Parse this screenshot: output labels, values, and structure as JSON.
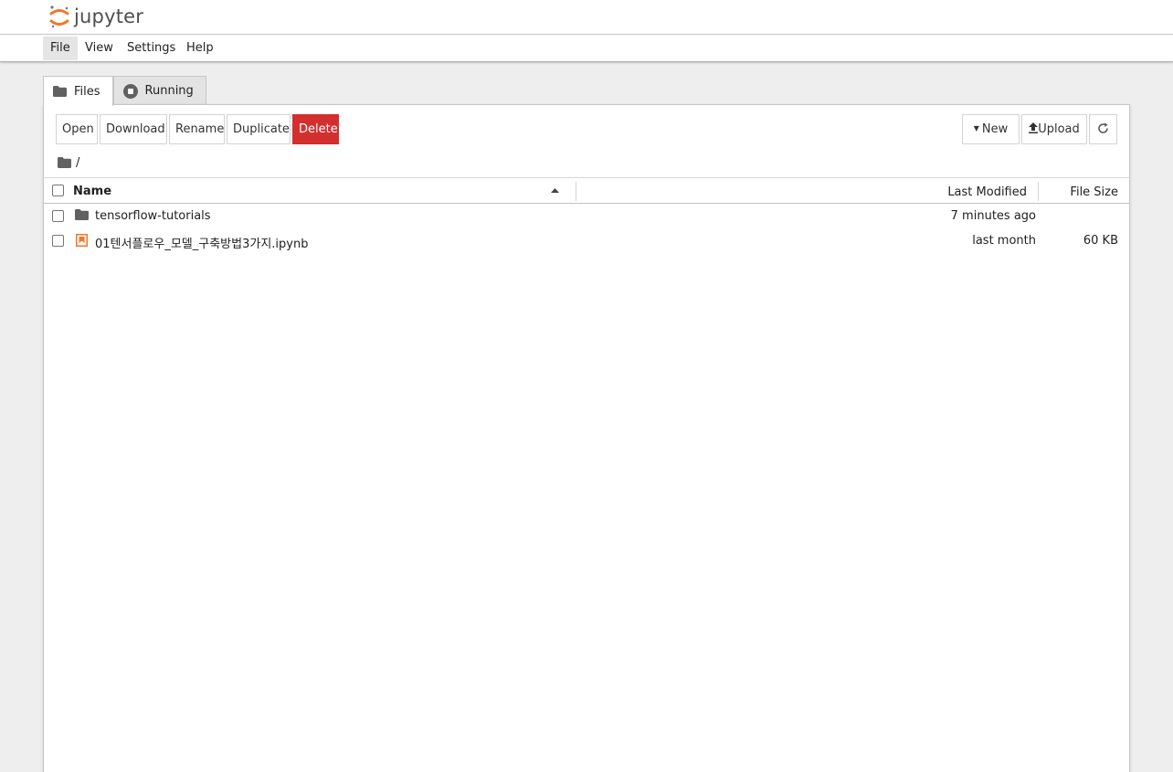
{
  "app": {
    "logo_text": "jupyter"
  },
  "menu": {
    "items": [
      "File",
      "View",
      "Settings",
      "Help"
    ]
  },
  "tabs": [
    {
      "label": "Files",
      "icon": "folder-icon"
    },
    {
      "label": "Running",
      "icon": "stop-circle-icon"
    }
  ],
  "toolbar": {
    "open": "Open",
    "download": "Download",
    "rename": "Rename",
    "duplicate": "Duplicate",
    "delete": "Delete",
    "new": "New",
    "upload": "Upload",
    "refresh_icon": "refresh-icon"
  },
  "breadcrumb": {
    "path": "/"
  },
  "list": {
    "columns": {
      "name": "Name",
      "modified": "Last Modified",
      "size": "File Size"
    },
    "rows": [
      {
        "type": "directory",
        "icon": "folder-icon",
        "name": "tensorflow-tutorials",
        "modified": "7 minutes ago",
        "size": ""
      },
      {
        "type": "notebook",
        "icon": "notebook-icon",
        "name": "01텐서플로우_모델_구축방법3가지.ipynb",
        "modified": "last month",
        "size": "60 KB"
      }
    ]
  },
  "colors": {
    "accent_orange": "#f37626",
    "danger": "#d32f2f",
    "icon_gray": "#616161"
  }
}
